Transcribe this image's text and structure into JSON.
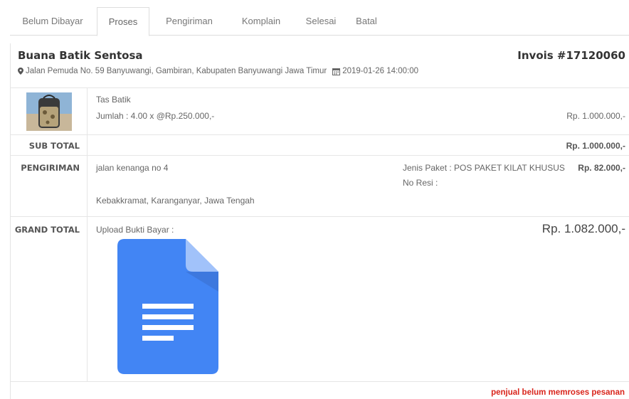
{
  "tabs": [
    "Belum Dibayar",
    "Proses",
    "Pengiriman",
    "Komplain",
    "Selesai",
    "Batal"
  ],
  "active_tab": "Proses",
  "order": {
    "shop_name": "Buana Batik Sentosa",
    "invoice": "Invois #17120060",
    "address": "Jalan Pemuda No. 59 Banyuwangi, Gambiran, Kabupaten Banyuwangi Jawa Timur",
    "date": "2019-01-26 14:00:00"
  },
  "item": {
    "name": "Tas Batik",
    "qty_line": "Jumlah : 4.00 x @Rp.250.000,-",
    "line_total": "Rp. 1.000.000,-"
  },
  "subtotal": {
    "label": "SUB TOTAL",
    "value": "Rp. 1.000.000,-"
  },
  "shipping": {
    "label": "PENGIRIMAN",
    "street": "jalan kenanga no 4",
    "city": "Kebakkramat, Karanganyar, Jawa Tengah",
    "package": "Jenis Paket : POS PAKET KILAT KHUSUS",
    "resi": "No Resi :",
    "cost": "Rp. 82.000,-"
  },
  "grand_total": {
    "label": "GRAND TOTAL",
    "upload_label": "Upload Bukti Bayar :",
    "value": "Rp. 1.082.000,-"
  },
  "status_note": "penjual belum memroses pesanan",
  "colors": {
    "doc_blue": "#4285f4",
    "doc_fold": "#a1c2fa",
    "note_red": "#d9251c"
  }
}
